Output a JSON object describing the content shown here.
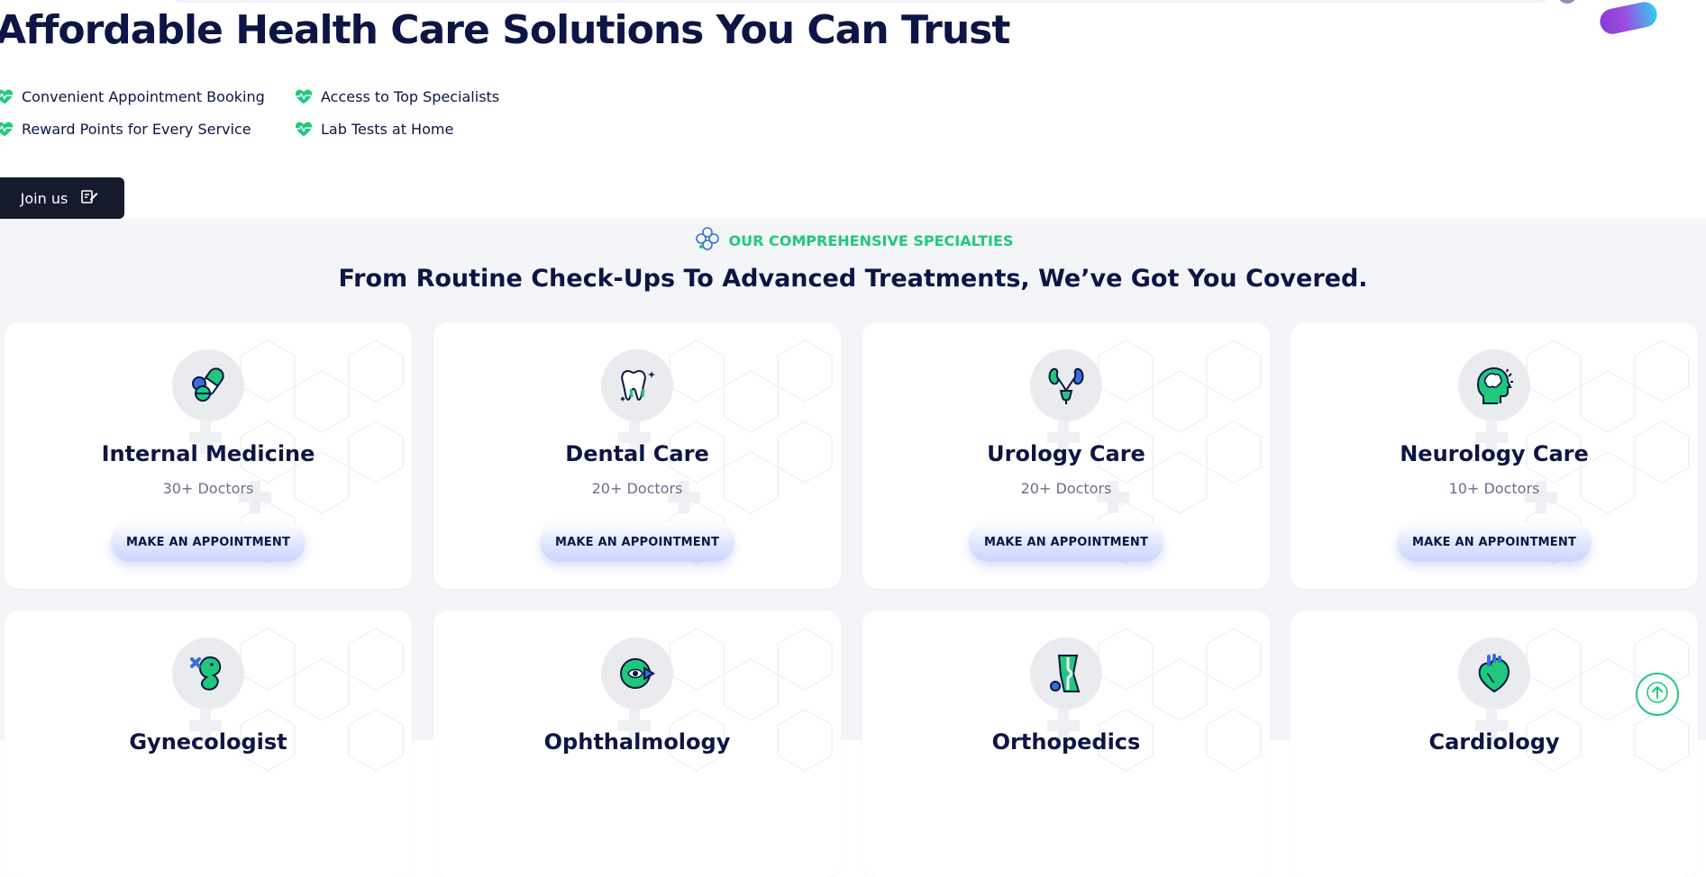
{
  "hero": {
    "title": "Affordable Health Care Solutions You Can Trust",
    "features": [
      {
        "label": "Convenient Appointment Booking",
        "icon": "heartbeat-icon"
      },
      {
        "label": "Access to Top Specialists",
        "icon": "heartbeat-icon"
      },
      {
        "label": "Reward Points for Every Service",
        "icon": "heartbeat-icon"
      },
      {
        "label": "Lab Tests at Home",
        "icon": "heartbeat-icon"
      }
    ],
    "join_label": "Join us",
    "join_icon": "signup-icon"
  },
  "specialties": {
    "eyebrow": "OUR COMPREHENSIVE SPECIALTIES",
    "title": "From Routine Check-Ups To Advanced Treatments, We’ve Got You Covered.",
    "cards": [
      {
        "title": "Internal Medicine",
        "sub": "30+ Doctors",
        "cta": "MAKE AN APPOINTMENT",
        "icon": "capsule-icon"
      },
      {
        "title": "Dental Care",
        "sub": "20+ Doctors",
        "cta": "MAKE AN APPOINTMENT",
        "icon": "tooth-icon"
      },
      {
        "title": "Urology Care",
        "sub": "20+ Doctors",
        "cta": "MAKE AN APPOINTMENT",
        "icon": "kidney-icon"
      },
      {
        "title": "Neurology Care",
        "sub": "10+ Doctors",
        "cta": "MAKE AN APPOINTMENT",
        "icon": "brain-head-icon"
      },
      {
        "title": "Gynecologist",
        "icon": "fetus-icon"
      },
      {
        "title": "Ophthalmology",
        "icon": "eye-icon"
      },
      {
        "title": "Orthopedics",
        "icon": "bone-joint-icon"
      },
      {
        "title": "Cardiology",
        "icon": "heart-organ-icon"
      }
    ]
  },
  "colors": {
    "navy": "#0d1545",
    "green": "#1fc97c",
    "button_dark": "#151a2d",
    "section_bg": "#f4f5f8"
  },
  "scroll_top_icon": "arrow-up-icon"
}
